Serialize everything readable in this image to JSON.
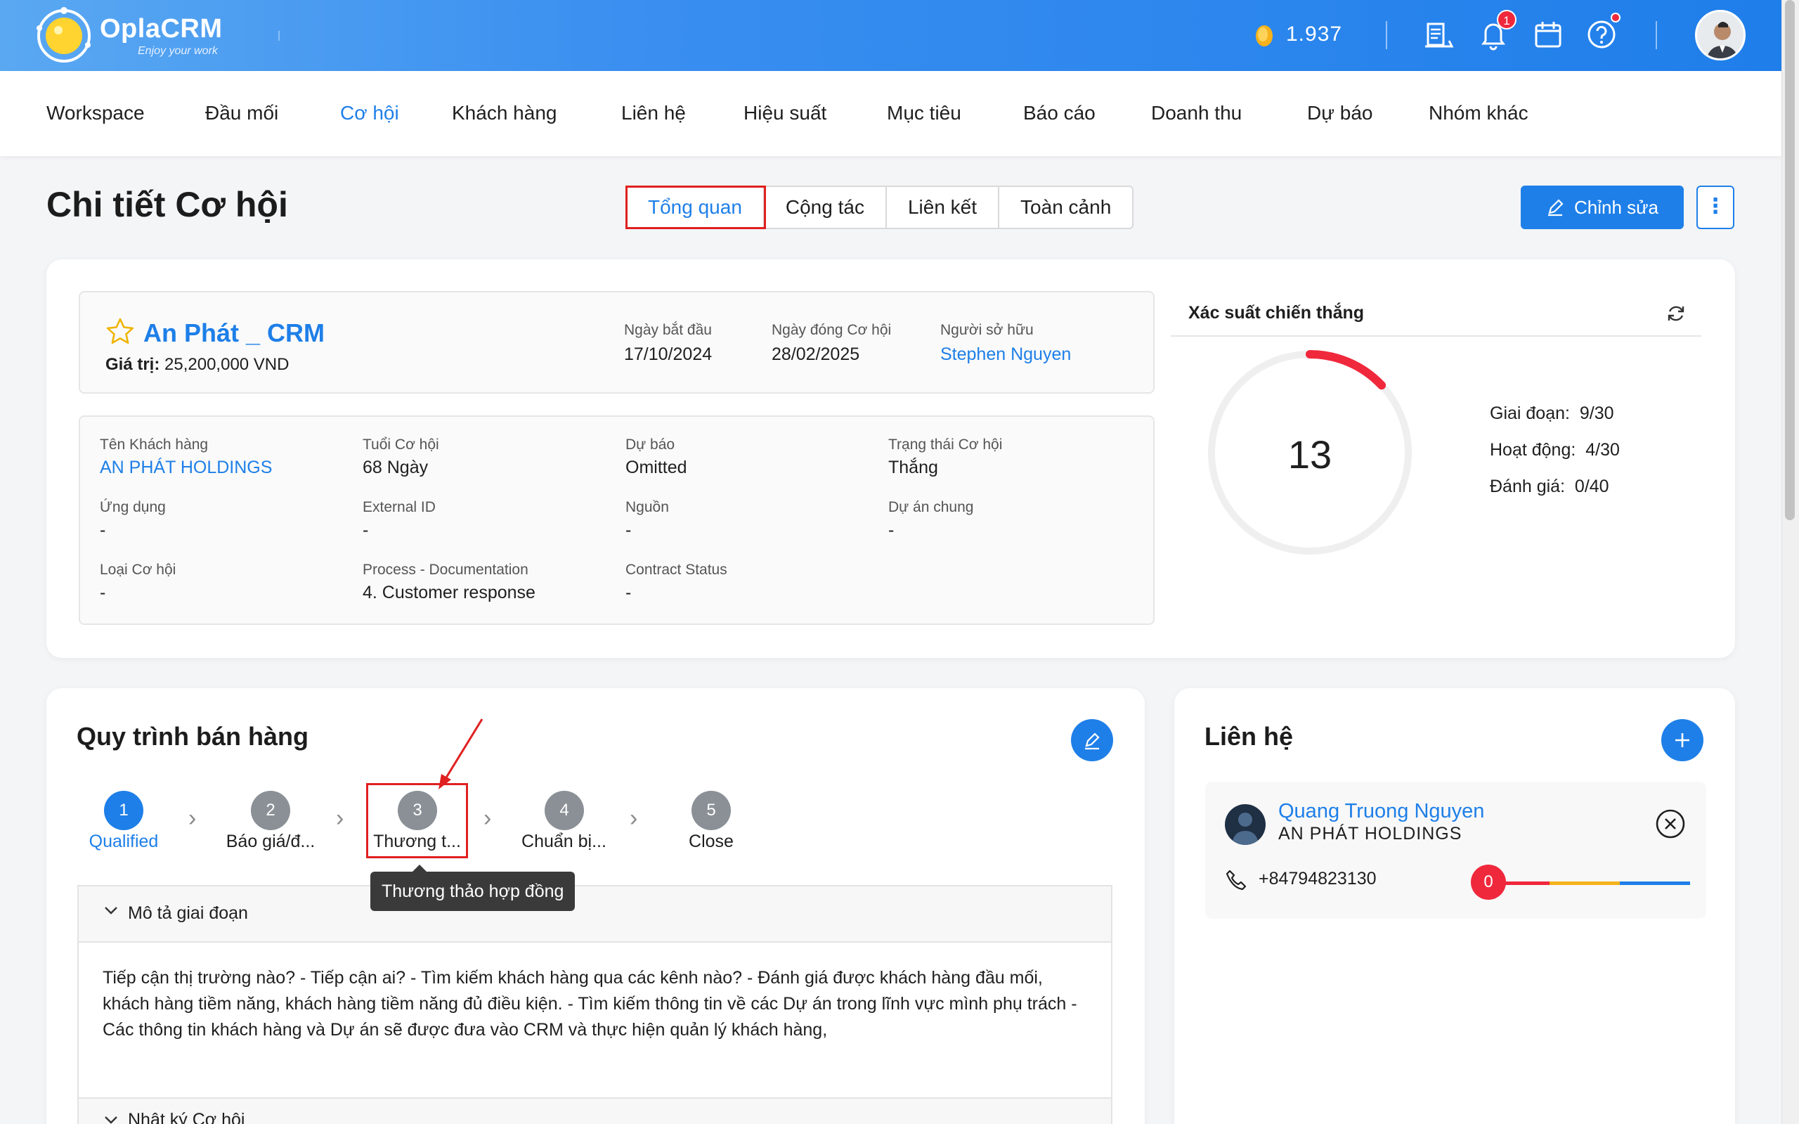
{
  "app": {
    "brand": "OplaCRM",
    "tagline": "Enjoy your work",
    "coins": "1.937",
    "notification_count": "1"
  },
  "nav": {
    "items": [
      "Workspace",
      "Đầu mối",
      "Cơ hội",
      "Khách hàng",
      "Liên hệ",
      "Hiệu suất",
      "Mục tiêu",
      "Báo cáo",
      "Doanh thu",
      "Dự báo",
      "Nhóm khác"
    ],
    "active": "Cơ hội"
  },
  "page": {
    "title": "Chi tiết Cơ hội",
    "tabs": [
      "Tổng quan",
      "Cộng tác",
      "Liên kết",
      "Toàn cảnh"
    ],
    "active_tab": "Tổng quan",
    "edit_label": "Chỉnh sửa",
    "more_label": "⋮"
  },
  "opportunity": {
    "name": "An Phát _ CRM",
    "value_label": "Giá trị:",
    "value": "25,200,000 VND",
    "start_date_label": "Ngày bắt đầu",
    "start_date": "17/10/2024",
    "close_date_label": "Ngày đóng Cơ hội",
    "close_date": "28/02/2025",
    "owner_label": "Người sở hữu",
    "owner": "Stephen Nguyen",
    "fields": [
      {
        "label": "Tên Khách hàng",
        "value": "AN PHÁT HOLDINGS",
        "link": true
      },
      {
        "label": "Tuổi Cơ hội",
        "value": "68 Ngày",
        "link": false
      },
      {
        "label": "Dự báo",
        "value": "Omitted",
        "link": false
      },
      {
        "label": "Trạng thái Cơ hội",
        "value": "Thắng",
        "link": false
      },
      {
        "label": "Ứng dụng",
        "value": "-",
        "link": false
      },
      {
        "label": "External ID",
        "value": "-",
        "link": false
      },
      {
        "label": "Nguồn",
        "value": "-",
        "link": false
      },
      {
        "label": "Dự án chung",
        "value": "-",
        "link": false
      },
      {
        "label": "Loại Cơ hội",
        "value": "-",
        "link": false
      },
      {
        "label": "Process - Documentation",
        "value": "4. Customer response",
        "link": false
      },
      {
        "label": "Contract Status",
        "value": "-",
        "link": false
      }
    ]
  },
  "probability": {
    "title": "Xác suất chiến thắng",
    "score": "13",
    "score_fraction": 0.13,
    "accent": "#f0283c",
    "stats": [
      {
        "label": "Giai đoạn",
        "value": "9/30"
      },
      {
        "label": "Hoạt động",
        "value": "4/30"
      },
      {
        "label": "Đánh giá",
        "value": "0/40"
      }
    ]
  },
  "sales_process": {
    "title": "Quy trình bán hàng",
    "steps": [
      {
        "num": "1",
        "label": "Qualified",
        "active": true
      },
      {
        "num": "2",
        "label": "Báo giá/đ...",
        "active": false
      },
      {
        "num": "3",
        "label": "Thương t...",
        "active": false
      },
      {
        "num": "4",
        "label": "Chuẩn bị...",
        "active": false
      },
      {
        "num": "5",
        "label": "Close",
        "active": false
      }
    ],
    "tooltip": "Thương thảo hợp đồng",
    "stage_desc_title": "Mô tả giai đoạn",
    "stage_desc": "Tiếp cận thị trường nào? - Tiếp cận ai? - Tìm kiếm khách hàng qua các kênh nào? - Đánh giá được khách hàng đầu mối, khách hàng tiềm năng, khách hàng tiềm năng đủ điều kiện. - Tìm kiếm thông tin về các Dự án trong lĩnh vực mình phụ trách - Các thông tin khách hàng và Dự án sẽ được đưa vào CRM và thực hiện quản lý khách hàng,",
    "log_title": "Nhật ký Cơ hội"
  },
  "contacts": {
    "title": "Liên hệ",
    "items": [
      {
        "name": "Quang Truong Nguyen",
        "company": "AN PHÁT HOLDINGS",
        "phone": "+84794823130",
        "score": "0"
      }
    ]
  },
  "colors": {
    "primary": "#1e7fe8",
    "danger": "#f0283c",
    "header_gradient_start": "#5aa8f2",
    "header_gradient_end": "#1f7eea"
  }
}
